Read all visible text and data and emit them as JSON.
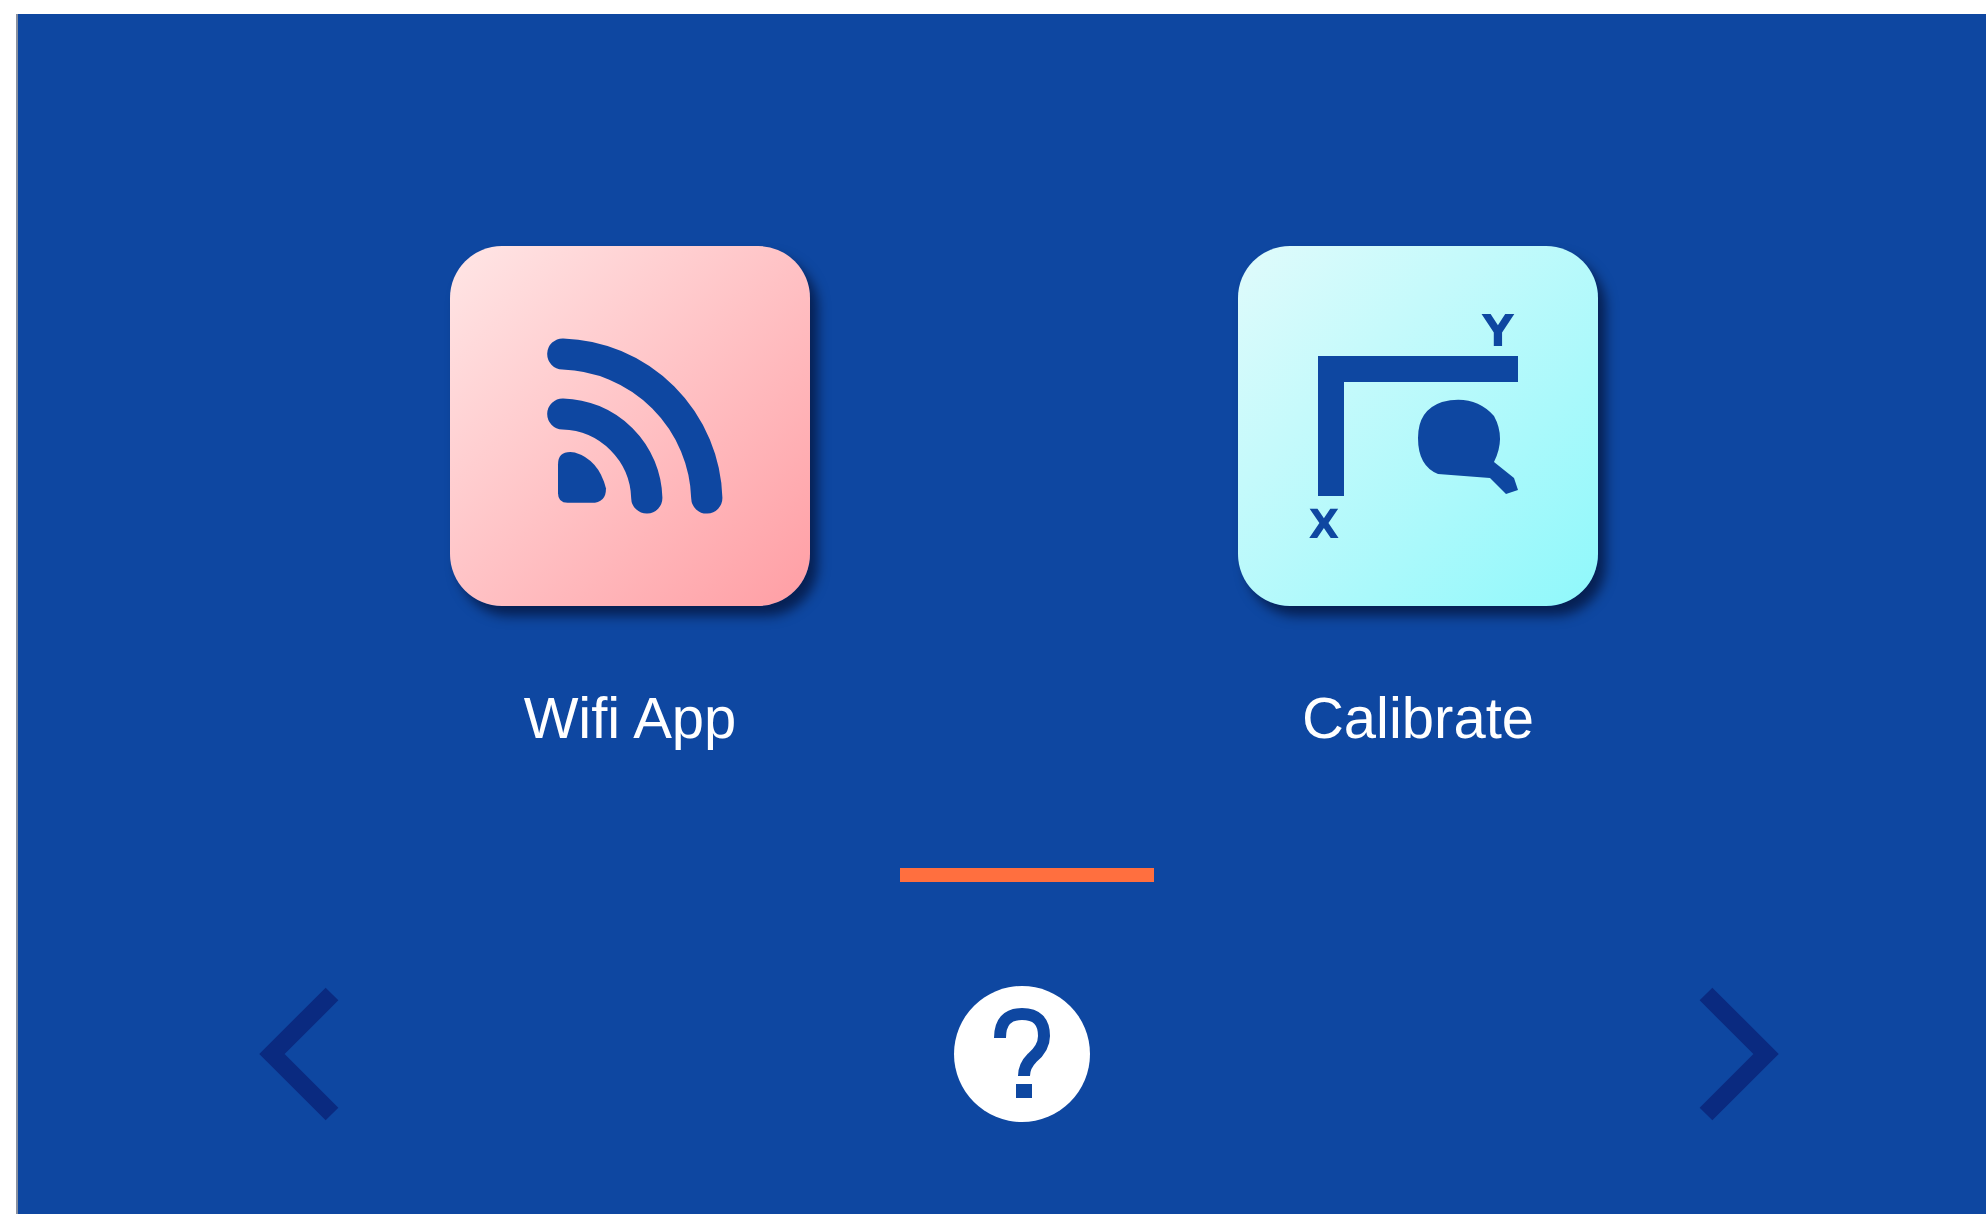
{
  "apps": [
    {
      "kind": "wifi",
      "label": "Wifi App"
    },
    {
      "kind": "calibrate",
      "label": "Calibrate",
      "x_label": "X",
      "y_label": "Y"
    }
  ],
  "pages": [
    {
      "selected": true
    }
  ],
  "nav": {
    "prev": true,
    "help": true,
    "next": true
  }
}
